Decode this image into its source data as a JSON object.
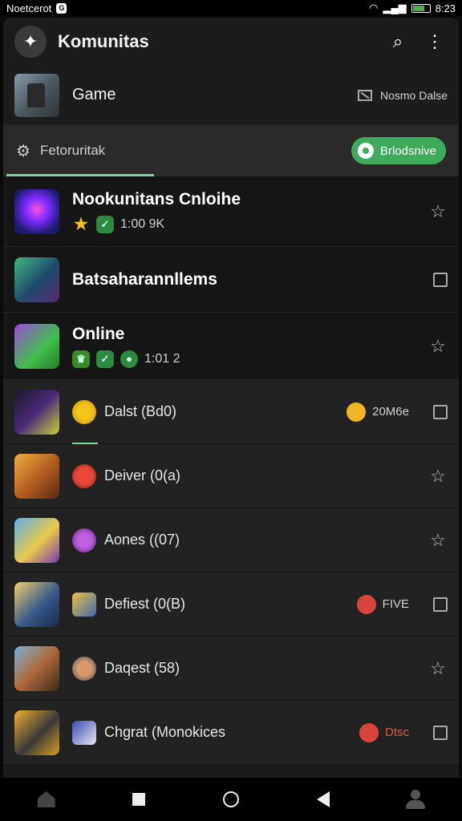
{
  "status": {
    "carrier": "Noetcerot",
    "badge": "G",
    "time": "8:23"
  },
  "appbar": {
    "title": "Komunitas"
  },
  "game": {
    "title": "Game",
    "right_label": "Nosmo Dalse"
  },
  "filter": {
    "label": "Fetoruritak",
    "pill_label": "Brlodsnive"
  },
  "featured": [
    {
      "title": "Nookunitans Cnloihe",
      "sub_count": "1:00 9K",
      "action": "star"
    },
    {
      "title": "Batsaharannllems",
      "sub_count": "",
      "action": "check"
    },
    {
      "title": "Online",
      "sub_count": "1:01 2",
      "action": "star"
    }
  ],
  "categories": [
    {
      "label": "Dalst (Bd0)",
      "tag": "20M6e",
      "tag_color": "#f0b429",
      "action": "check"
    },
    {
      "label": "Deiver (0(a)",
      "tag": "",
      "tag_color": "",
      "action": "star"
    },
    {
      "label": "Aones ((07)",
      "tag": "",
      "tag_color": "",
      "action": "star"
    },
    {
      "label": "Defiest (0(B)",
      "tag": "FIVE",
      "tag_color": "#d9443c",
      "action": "check"
    },
    {
      "label": "Daqest (58)",
      "tag": "",
      "tag_color": "",
      "action": "star"
    },
    {
      "label": "Chgrat (Monokices",
      "tag": "Dtsc",
      "tag_color": "#d9443c",
      "action": "check"
    }
  ],
  "colors": {
    "accent": "#3daa5c",
    "underline": "#7fd49a",
    "background": "#1c1c1c"
  }
}
